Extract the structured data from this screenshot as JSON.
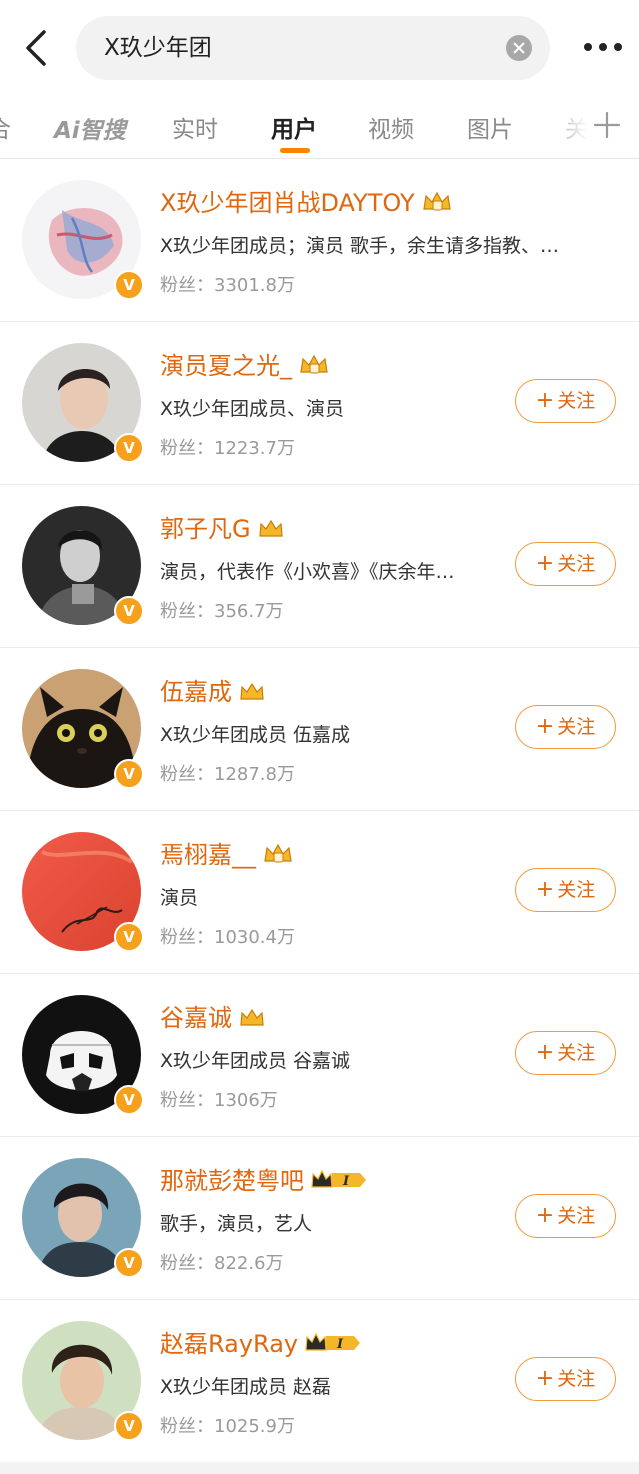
{
  "search": {
    "query": "X玖少年团"
  },
  "tabs": {
    "partial_left": "合",
    "ai": "Ai智搜",
    "items": [
      "实时",
      "用户",
      "视频",
      "图片",
      "关"
    ],
    "active": "用户"
  },
  "colors": {
    "accent": "#ff8200",
    "name": "#e0670d",
    "verified": "#f7a01b"
  },
  "icons": [
    "back-arrow-icon",
    "clear-icon",
    "more-icon",
    "add-tab-icon",
    "crown-icon",
    "verified-v-icon"
  ],
  "follow_label": "关注",
  "follow_plus": "+",
  "users": [
    {
      "name": "X玖少年团肖战DAYTOY",
      "desc": "X玖少年团成员；演员 歌手，余生请多指教、…",
      "fans": "粉丝：3301.8万",
      "badge_level": "",
      "followable": false
    },
    {
      "name": "演员夏之光_",
      "desc": "X玖少年团成员、演员",
      "fans": "粉丝：1223.7万",
      "badge_level": "",
      "followable": true
    },
    {
      "name": "郭子凡G",
      "desc": "演员，代表作《小欢喜》《庆余年…",
      "fans": "粉丝：356.7万",
      "badge_level": "",
      "followable": true
    },
    {
      "name": "伍嘉成",
      "desc": "X玖少年团成员 伍嘉成",
      "fans": "粉丝：1287.8万",
      "badge_level": "",
      "followable": true
    },
    {
      "name": "焉栩嘉__",
      "desc": "演员",
      "fans": "粉丝：1030.4万",
      "badge_level": "",
      "followable": true
    },
    {
      "name": "谷嘉诚",
      "desc": "X玖少年团成员 谷嘉诚",
      "fans": "粉丝：1306万",
      "badge_level": "",
      "followable": true
    },
    {
      "name": "那就彭楚粤吧",
      "desc": "歌手，演员，艺人",
      "fans": "粉丝：822.6万",
      "badge_level": "I",
      "followable": true
    },
    {
      "name": "赵磊RayRay",
      "desc": "X玖少年团成员 赵磊",
      "fans": "粉丝：1025.9万",
      "badge_level": "I",
      "followable": true
    }
  ]
}
